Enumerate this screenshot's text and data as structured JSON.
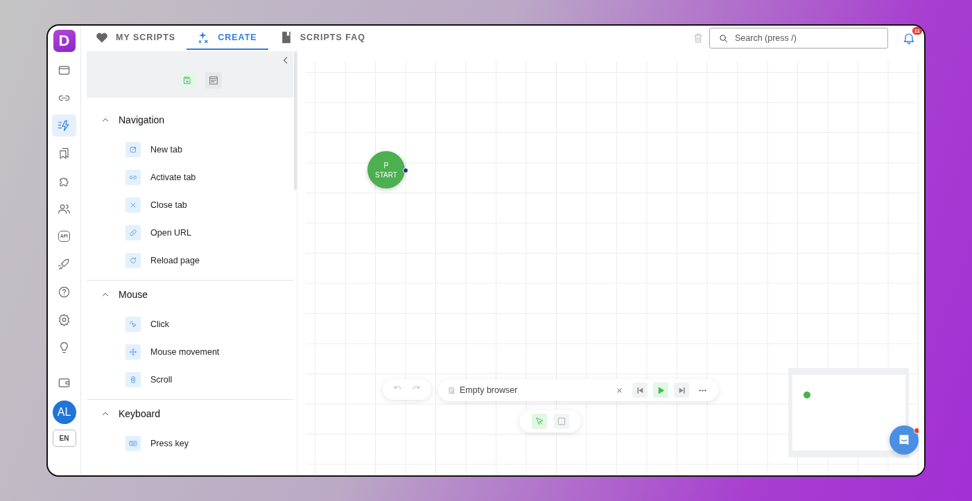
{
  "logo": {
    "letter": "D"
  },
  "rail": {
    "items": [
      {
        "kind": "browser",
        "selected": false
      },
      {
        "kind": "link",
        "selected": false
      },
      {
        "kind": "bolt",
        "selected": true
      },
      {
        "kind": "bookmarks",
        "selected": false
      },
      {
        "kind": "puzzle",
        "selected": false
      },
      {
        "kind": "users",
        "selected": false
      },
      {
        "kind": "api",
        "label": "API",
        "selected": false
      },
      {
        "kind": "rocket",
        "selected": false
      },
      {
        "kind": "help",
        "selected": false
      },
      {
        "kind": "gear",
        "selected": false
      },
      {
        "kind": "bulb",
        "selected": false
      }
    ],
    "wallet": {
      "kind": "wallet"
    },
    "avatar": "AL",
    "language": "EN"
  },
  "tabs": [
    {
      "label": "MY SCRIPTS",
      "kind": "heart",
      "selected": false
    },
    {
      "label": "CREATE",
      "kind": "sparkle",
      "selected": true
    },
    {
      "label": "SCRIPTS FAQ",
      "kind": "book",
      "selected": false
    }
  ],
  "search": {
    "placeholder": "Search (press /)"
  },
  "notifications": {
    "count": "11"
  },
  "panel": {
    "sections": [
      {
        "title": "Navigation",
        "expanded": true,
        "items": [
          {
            "label": "New tab",
            "kind": "external"
          },
          {
            "label": "Activate tab",
            "kind": "link"
          },
          {
            "label": "Close tab",
            "kind": "close"
          },
          {
            "label": "Open URL",
            "kind": "chain"
          },
          {
            "label": "Reload page",
            "kind": "reload"
          }
        ]
      },
      {
        "title": "Mouse",
        "expanded": true,
        "items": [
          {
            "label": "Click",
            "kind": "click"
          },
          {
            "label": "Mouse movement",
            "kind": "move"
          },
          {
            "label": "Scroll",
            "kind": "scroll"
          }
        ]
      },
      {
        "title": "Keyboard",
        "expanded": true,
        "items": [
          {
            "label": "Press key",
            "kind": "keyboard"
          }
        ]
      }
    ]
  },
  "canvas": {
    "start_node": {
      "label": "START"
    },
    "browser_bar": {
      "label": "Empty browser"
    },
    "tools": [
      {
        "kind": "pointer",
        "selected": true
      },
      {
        "kind": "frame",
        "selected": false
      }
    ]
  }
}
